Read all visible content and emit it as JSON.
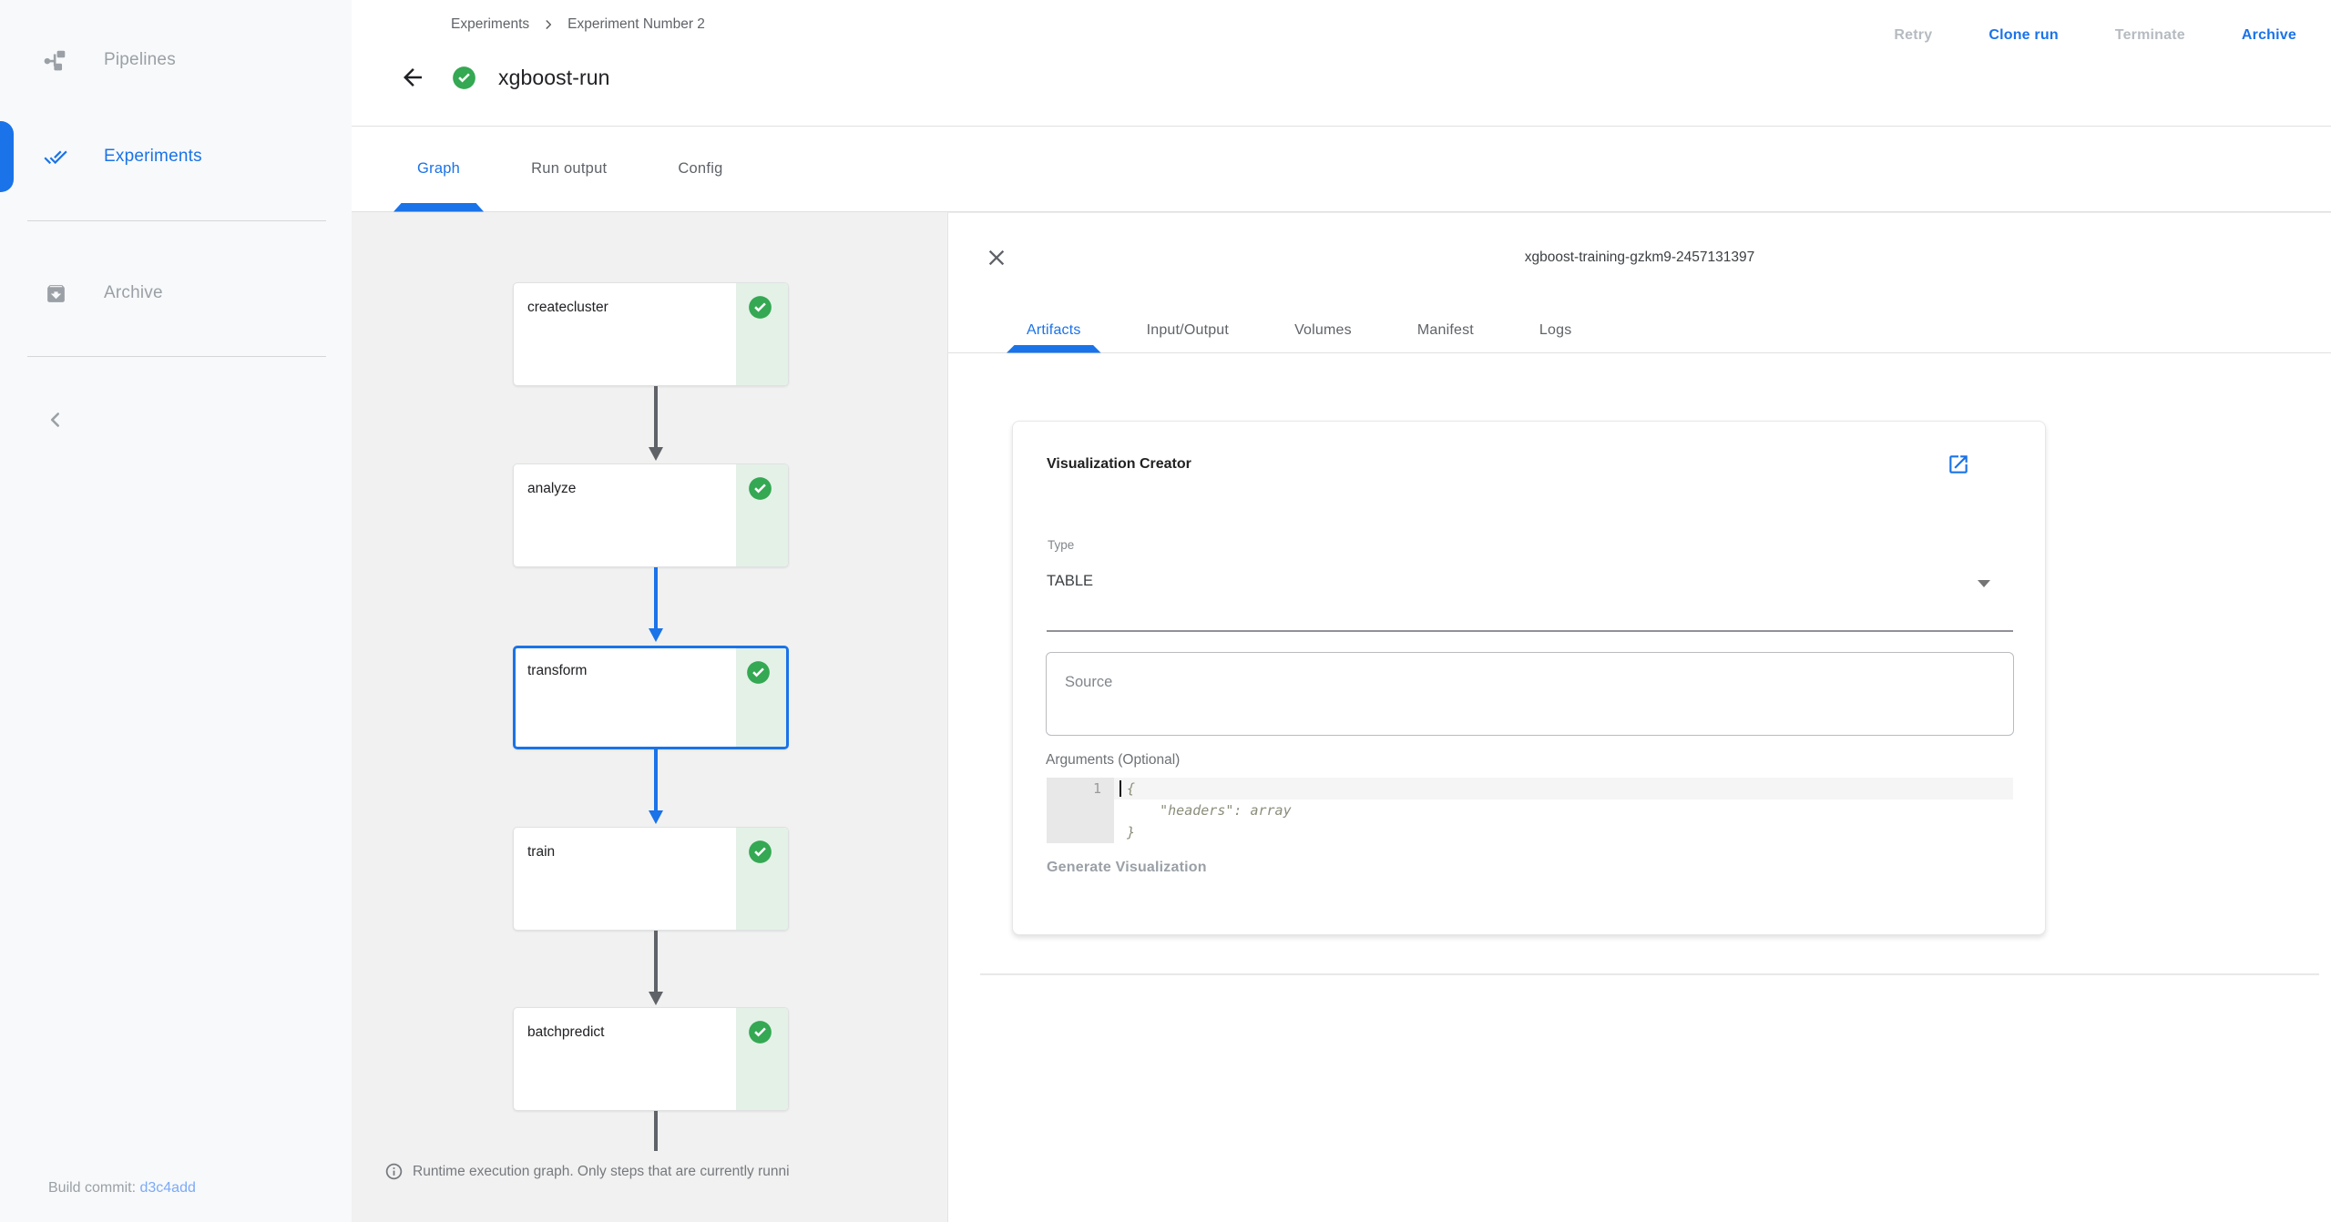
{
  "colors": {
    "accent": "#1a73e8",
    "success_green": "#34a853",
    "success_strip": "#e4f1e7",
    "link_light_blue": "#7baaf7",
    "disabled_gray": "#9aa0a6"
  },
  "sidebar": {
    "items": [
      {
        "label": "Pipelines"
      },
      {
        "label": "Experiments",
        "active": true
      },
      {
        "label": "Archive"
      }
    ],
    "build_commit_label": "Build commit: ",
    "build_commit_value": "d3c4add"
  },
  "header": {
    "breadcrumb": [
      "Experiments",
      "Experiment Number 2"
    ],
    "title": "xgboost-run",
    "actions": [
      {
        "label": "Retry",
        "enabled": false
      },
      {
        "label": "Clone run",
        "enabled": true
      },
      {
        "label": "Terminate",
        "enabled": false
      },
      {
        "label": "Archive",
        "enabled": true
      }
    ]
  },
  "tabs": [
    {
      "label": "Graph",
      "active": true
    },
    {
      "label": "Run output"
    },
    {
      "label": "Config"
    }
  ],
  "graph": {
    "nodes": [
      {
        "label": "createcluster",
        "status": "succeeded"
      },
      {
        "label": "analyze",
        "status": "succeeded"
      },
      {
        "label": "transform",
        "status": "succeeded",
        "selected": true
      },
      {
        "label": "train",
        "status": "succeeded"
      },
      {
        "label": "batchpredict",
        "status": "succeeded"
      }
    ],
    "note": "Runtime execution graph. Only steps that are currently runni"
  },
  "panel": {
    "title": "xgboost-training-gzkm9-2457131397",
    "tabs": [
      {
        "label": "Artifacts",
        "active": true
      },
      {
        "label": "Input/Output"
      },
      {
        "label": "Volumes"
      },
      {
        "label": "Manifest"
      },
      {
        "label": "Logs"
      }
    ],
    "viz_creator": {
      "title": "Visualization Creator",
      "type_label": "Type",
      "type_value": "TABLE",
      "source_placeholder": "Source",
      "arguments_label": "Arguments (Optional)",
      "code_line_number": "1",
      "code_lines": [
        "{",
        "    \"headers\": array",
        "}"
      ],
      "generate_label": "Generate Visualization"
    }
  }
}
